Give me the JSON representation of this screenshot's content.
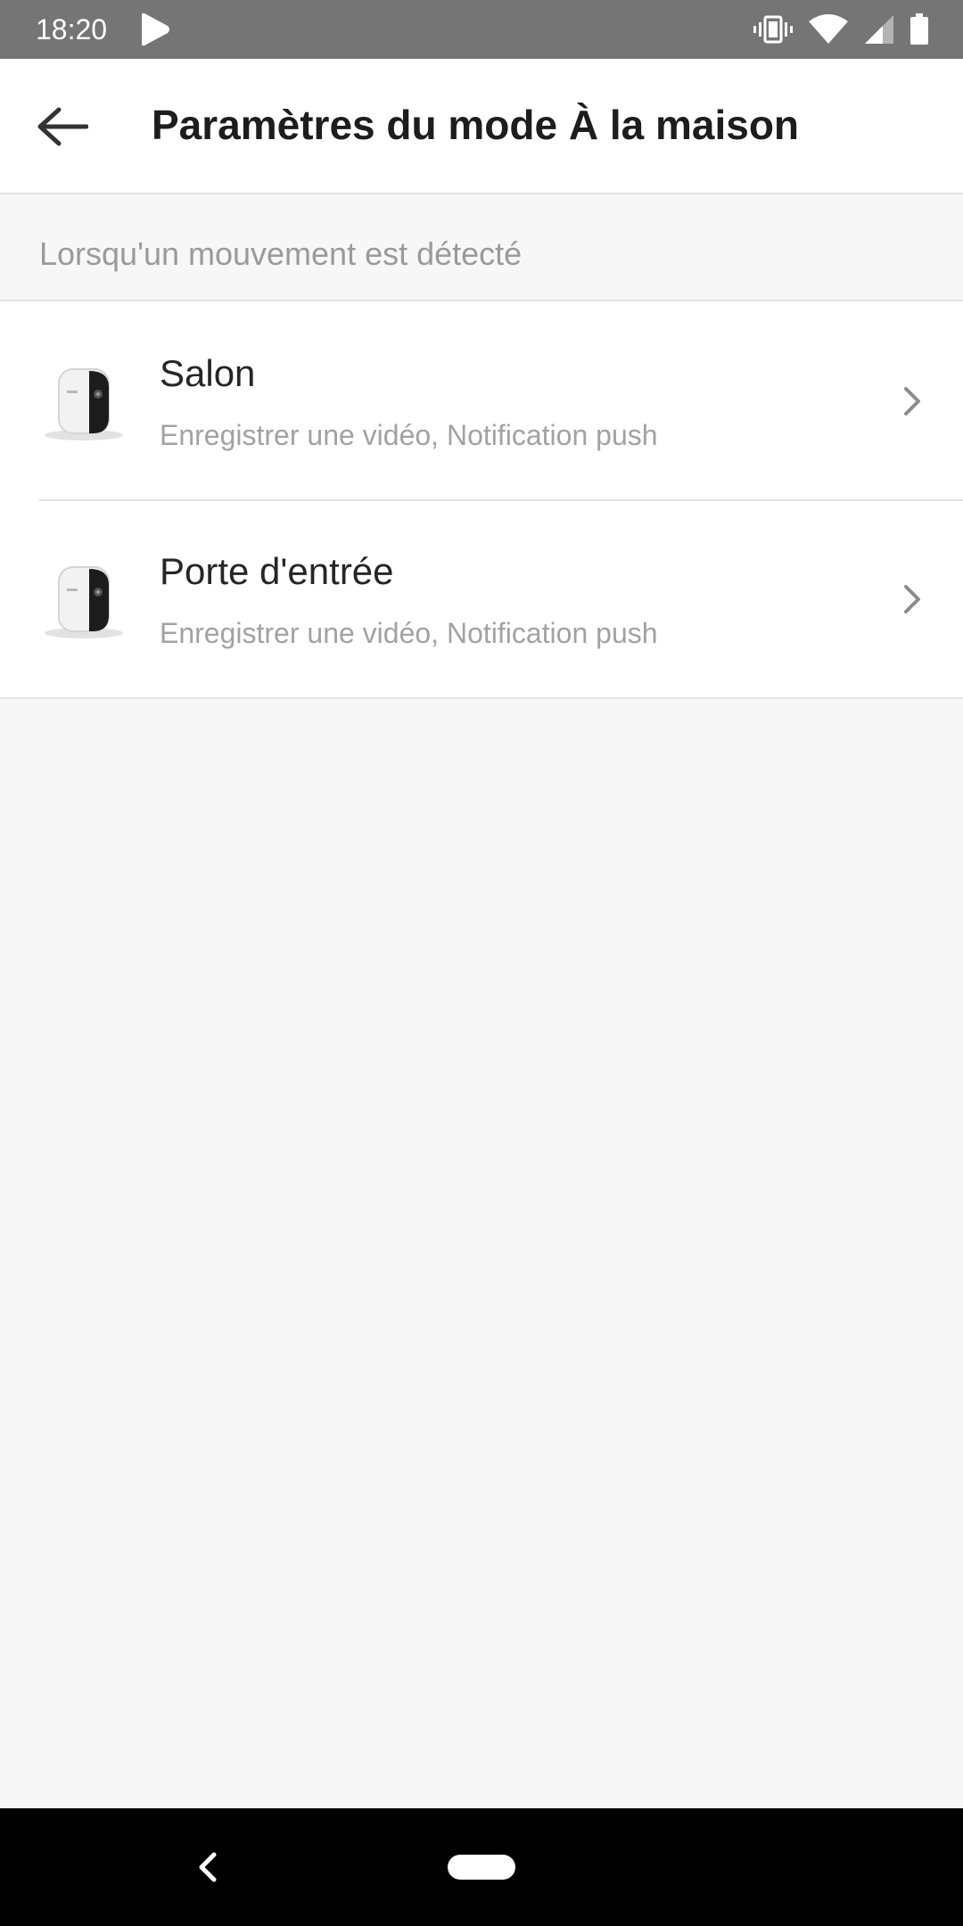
{
  "status_bar": {
    "time": "18:20",
    "left_icon": "play-store-icon",
    "right_icons": [
      "vibrate-icon",
      "wifi-icon",
      "cell-signal-icon",
      "battery-icon"
    ]
  },
  "header": {
    "back_icon": "arrow-left-icon",
    "title": "Paramètres du mode À la maison"
  },
  "section": {
    "label": "Lorsqu'un mouvement est détecté"
  },
  "devices": [
    {
      "name": "Salon",
      "actions": "Enregistrer une vidéo, Notification push",
      "icon": "camera-thumbnail"
    },
    {
      "name": "Porte d'entrée",
      "actions": "Enregistrer une vidéo, Notification push",
      "icon": "camera-thumbnail"
    }
  ],
  "nav_bar": {
    "back_icon": "nav-back-icon",
    "home_icon": "nav-home-pill"
  },
  "colors": {
    "status_bar": "#757575",
    "app_bar": "#ffffff",
    "background": "#f7f7f7",
    "title_text": "#1d1d1d",
    "secondary_text": "#a2a2a2",
    "divider": "#e3e3e3",
    "nav_bar": "#000000"
  }
}
